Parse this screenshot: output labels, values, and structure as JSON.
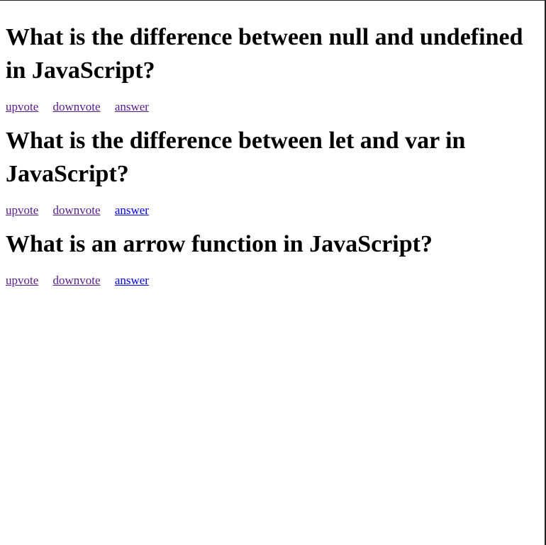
{
  "questions": [
    {
      "title": "What is the difference between null and undefined in JavaScript?",
      "upvote": "upvote",
      "downvote": "downvote",
      "answer": "answer"
    },
    {
      "title": "What is the difference between let and var in JavaScript?",
      "upvote": "upvote",
      "downvote": "downvote",
      "answer": "answer"
    },
    {
      "title": "What is an arrow function in JavaScript?",
      "upvote": "upvote",
      "downvote": "downvote",
      "answer": "answer"
    }
  ],
  "colors": {
    "visited_link": "#551a8b",
    "link": "#0000ee",
    "text": "#000000"
  }
}
